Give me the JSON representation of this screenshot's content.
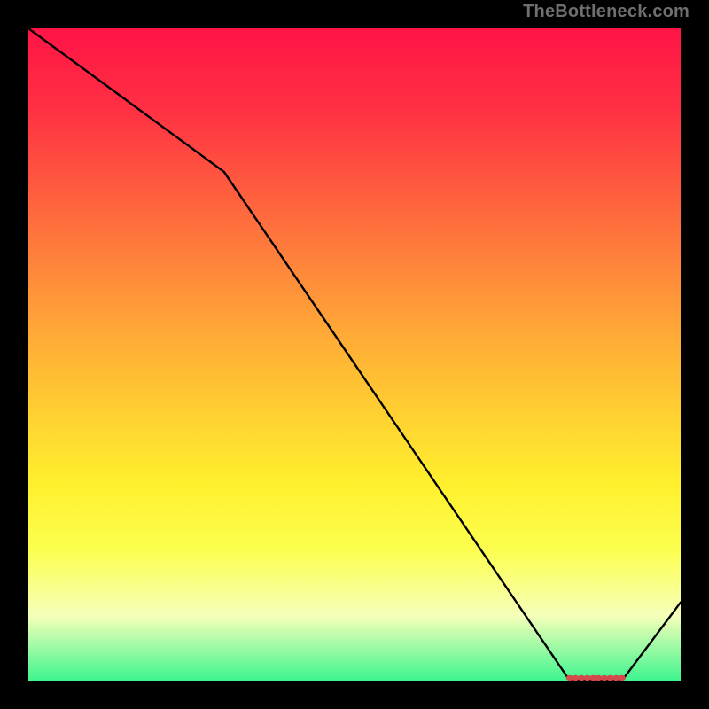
{
  "attribution": "TheBottleneck.com",
  "chart_data": {
    "type": "line",
    "title": "",
    "xlabel": "",
    "ylabel": "",
    "xlim": [
      0,
      100
    ],
    "ylim": [
      0,
      100
    ],
    "grid": false,
    "legend": false,
    "x": [
      0,
      30,
      83,
      91,
      100
    ],
    "values": [
      100,
      78,
      0,
      0,
      12
    ],
    "marker_region": {
      "x_start": 83,
      "x_end": 91,
      "y": 0
    },
    "markers_x": [
      83.0,
      83.9,
      84.8,
      85.7,
      86.6,
      87.4,
      88.3,
      89.2,
      90.1,
      91.0
    ],
    "line_color": "#000000",
    "marker_color": "#d34a4a"
  }
}
